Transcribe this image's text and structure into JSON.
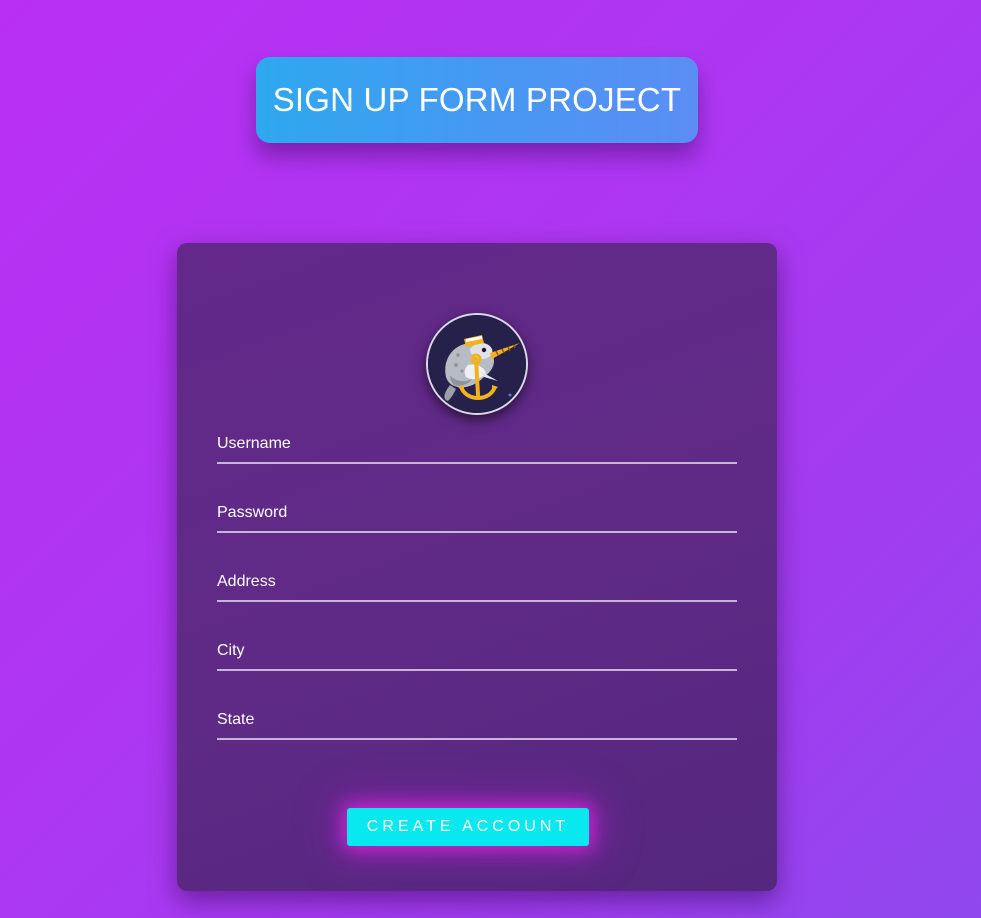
{
  "header": {
    "title": "SIGN UP FORM PROJECT"
  },
  "form": {
    "avatar_icon": "narwhal-anchor-logo",
    "fields": {
      "username": {
        "value": "",
        "placeholder": "Username"
      },
      "password": {
        "value": "",
        "placeholder": "Password"
      },
      "address": {
        "value": "",
        "placeholder": "Address"
      },
      "city": {
        "value": "",
        "placeholder": "City"
      },
      "state": {
        "value": "",
        "placeholder": "State"
      }
    },
    "submit_label": "CREATE ACCOUNT"
  },
  "colors": {
    "background": "#b230f3",
    "title_gradient_start": "#2ea8ef",
    "title_gradient_end": "#5b8ef5",
    "card": "#5f2a86",
    "button": "#07e8ef",
    "button_glow": "#e628e6",
    "underline": "#c8b3d9"
  }
}
